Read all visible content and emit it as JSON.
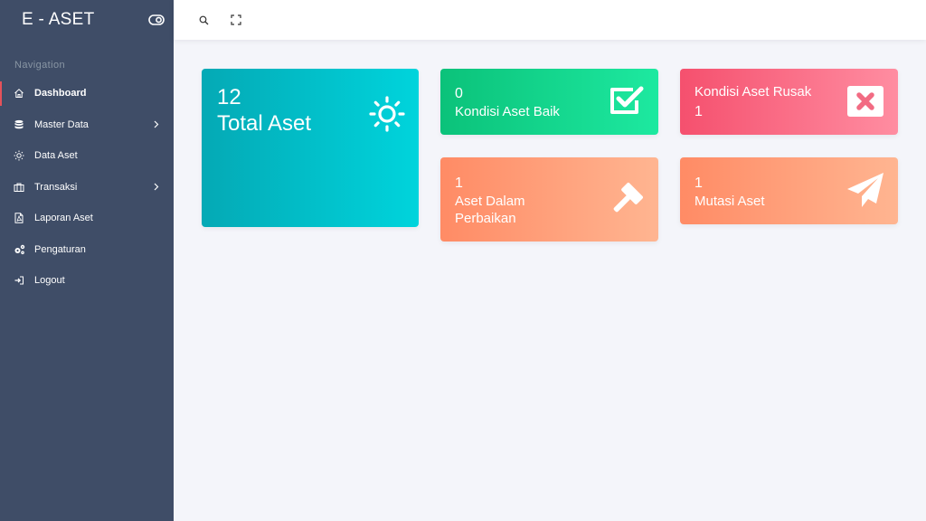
{
  "app": {
    "title": "E - ASET"
  },
  "sidebar": {
    "caption": "Navigation",
    "items": [
      {
        "label": "Dashboard",
        "icon": "home-icon",
        "active": true,
        "has_submenu": false
      },
      {
        "label": "Master Data",
        "icon": "database-icon",
        "active": false,
        "has_submenu": true
      },
      {
        "label": "Data Aset",
        "icon": "sun-icon",
        "active": false,
        "has_submenu": false
      },
      {
        "label": "Transaksi",
        "icon": "briefcase-icon",
        "active": false,
        "has_submenu": true
      },
      {
        "label": "Laporan Aset",
        "icon": "pdf-file-icon",
        "active": false,
        "has_submenu": false
      },
      {
        "label": "Pengaturan",
        "icon": "gears-icon",
        "active": false,
        "has_submenu": false
      },
      {
        "label": "Logout",
        "icon": "logout-icon",
        "active": false,
        "has_submenu": false
      }
    ]
  },
  "topbar": {
    "icons": [
      "search-icon",
      "fullscreen-icon"
    ]
  },
  "cards": {
    "total": {
      "value": "12",
      "label": "Total Aset",
      "icon": "sun-icon"
    },
    "baik": {
      "value": "0",
      "label": "Kondisi Aset Baik",
      "icon": "checkbox-icon"
    },
    "rusak": {
      "label": "Kondisi Aset Rusak",
      "value": "1",
      "icon": "close-box-icon"
    },
    "perbaikan": {
      "value": "1",
      "label_line1": "Aset Dalam",
      "label_line2": "Perbaikan",
      "icon": "gavel-icon"
    },
    "mutasi": {
      "value": "1",
      "label": "Mutasi Aset",
      "icon": "paper-plane-icon"
    }
  },
  "colors": {
    "sidebar_bg": "#3f4d67",
    "accent": "#e5525a",
    "total": "#04a9b5",
    "baik": "#0bc27a",
    "rusak": "#f5506e",
    "perbaikan": "#ff8b65",
    "mutasi": "#ff8b65"
  }
}
